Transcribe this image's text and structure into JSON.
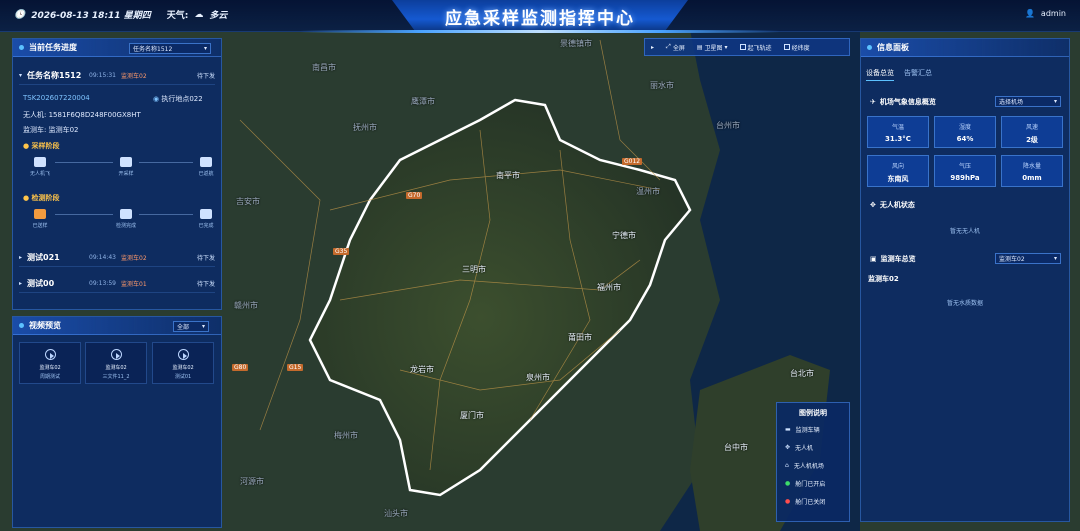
{
  "header": {
    "datetime": "2026-08-13 18:11 星期四",
    "weather_label": "天气:",
    "weather_value": "多云",
    "title": "应急采样监测指挥中心",
    "user": "admin"
  },
  "task_panel": {
    "title": "当前任务进度",
    "select_value": "任务名称1512",
    "expanded": {
      "name": "任务名称1512",
      "time": "09:15:31",
      "car": "监测车02",
      "status": "待下发",
      "task_id": "TSK202607220004",
      "location": "执行地点022",
      "drone": "无人机: 1581F6Q8D248F00GX8HT",
      "vehicle": "监测车: 监测车02"
    },
    "sampling_stage": "采样阶段",
    "sampling_steps": [
      "无人机飞",
      "开采样",
      "已返航"
    ],
    "detect_stage": "检测阶段",
    "detect_steps": [
      "已送样",
      "检测完成",
      "已完成"
    ],
    "others": [
      {
        "name": "测试021",
        "time": "09:14:43",
        "car": "监测车02",
        "status": "待下发"
      },
      {
        "name": "测试00",
        "time": "09:13:59",
        "car": "监测车01",
        "status": "待下发"
      }
    ]
  },
  "video_panel": {
    "title": "视频预览",
    "select_value": "全部",
    "tiles": [
      {
        "name": "监测车02",
        "sub": "周期测试"
      },
      {
        "name": "监测车02",
        "sub": "三文件11_2"
      },
      {
        "name": "监测车02",
        "sub": "测试01"
      }
    ]
  },
  "toolbar": {
    "full": "全屏",
    "satellite": "卫星图",
    "track": "起飞轨迹",
    "latlng": "经纬度"
  },
  "map": {
    "cities": [
      "南昌市",
      "鹰潭市",
      "抚州市",
      "景德镇市",
      "丽水市",
      "温州市",
      "台州市",
      "南平市",
      "宁德市",
      "三明市",
      "福州市",
      "吉安市",
      "赣州市",
      "龙岩市",
      "泉州市",
      "莆田市",
      "厦门市",
      "梅州市",
      "河源市",
      "汕头市",
      "台北市",
      "台中市"
    ],
    "roads": [
      "G70",
      "G35",
      "G80",
      "G15",
      "G012"
    ]
  },
  "info_panel": {
    "title": "信息面板",
    "tabs": [
      "设备总览",
      "告警汇总"
    ],
    "weather_title": "机场气象信息概览",
    "weather_select": "选择机场",
    "weather": [
      {
        "k": "气温",
        "v": "31.3°C"
      },
      {
        "k": "湿度",
        "v": "64%"
      },
      {
        "k": "风速",
        "v": "2级"
      },
      {
        "k": "风向",
        "v": "东南风"
      },
      {
        "k": "气压",
        "v": "989hPa"
      },
      {
        "k": "降水量",
        "v": "0mm"
      }
    ],
    "drone_title": "无人机状态",
    "drone_empty": "暂无无人机",
    "car_title": "监测车总览",
    "car_select": "监测车02",
    "car_name": "监测车02",
    "car_empty": "暂无水质数据"
  },
  "legend": {
    "title": "图例说明",
    "items": [
      "监测车辆",
      "无人机",
      "无人机机场",
      "舱门已开启",
      "舱门已关闭"
    ]
  }
}
